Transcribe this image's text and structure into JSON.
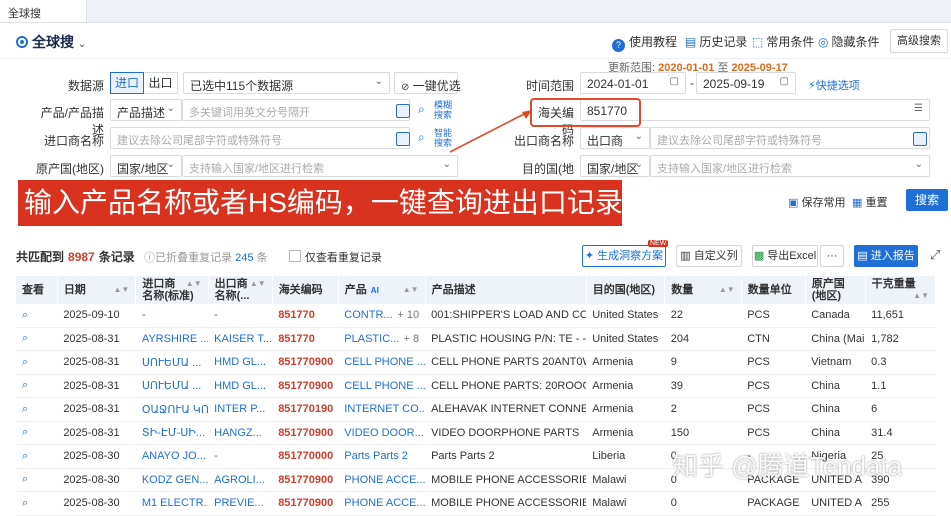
{
  "window": {
    "tab_title": "全球搜"
  },
  "header": {
    "logo": "全球搜",
    "nav": [
      "使用教程",
      "历史记录",
      "常用条件",
      "隐藏条件"
    ],
    "advanced": "高级搜索",
    "update_label": "更新范围:",
    "update_from": "2020-01-01",
    "update_to_word": "至",
    "update_to": "2025-09-17"
  },
  "form": {
    "datasource_label": "数据源",
    "import_label": "进口",
    "export_label": "出口",
    "datasource_value": "已选中115个数据源",
    "one_click": "一键优选",
    "time_label": "时间范围",
    "date_from": "2024-01-01",
    "date_to": "2025-09-19",
    "quick_options": "快捷选项",
    "product_label": "产品/产品描述",
    "product_type": "产品描述",
    "product_placeholder": "多关键词用英文分号隔开",
    "fuzzy_label1": "模糊",
    "fuzzy_label2": "搜索",
    "hs_label": "海关编码",
    "hs_value": "851770",
    "importer_label": "进口商名称",
    "importer_placeholder": "建议去除公司尾部字符或特殊符号",
    "smart_label1": "智能",
    "smart_label2": "搜索",
    "exporter_label": "出口商名称",
    "exporter_type": "出口商",
    "exporter_placeholder": "建议去除公司尾部字符或特殊符号",
    "origin_label": "原产国(地区)",
    "origin_type": "国家/地区",
    "origin_placeholder": "支持输入国家/地区进行检索",
    "dest_label": "目的国(地区)",
    "dest_type": "国家/地区",
    "dest_placeholder": "支持输入国家/地区进行检索",
    "save_common": "保存常用",
    "reset": "重置",
    "search": "搜索"
  },
  "banner": {
    "text": "输入产品名称或者HS编码，一键查询进出口记录"
  },
  "results": {
    "matched_label": "共匹配到",
    "count": "8987",
    "unit": "条记录",
    "folded_label": "已折叠重复记录",
    "folded_count": "245",
    "folded_unit": "条",
    "only_dup": "仅查看重复记录",
    "gen_solution": "生成洞察方案",
    "new_tag": "NEW",
    "custom_cols": "自定义列",
    "export_excel": "导出Excel",
    "more": "···",
    "report": "进入报告"
  },
  "table": {
    "headers": [
      "查看",
      "日期",
      "进口商名称(标准)",
      "出口商名称(...",
      "海关编码",
      "产品",
      "产品描述",
      "目的国(地区)",
      "数量",
      "数量单位",
      "原产国(地区)",
      "干克重量"
    ],
    "ai_tag": "AI",
    "rows": [
      [
        "2025-09-10",
        "-",
        "-",
        "851770",
        "CONTR...",
        "+ 10",
        "001:SHIPPER'S LOAD AND COU...",
        "United States",
        "22",
        "PCS",
        "Canada",
        "11,651"
      ],
      [
        "2025-08-31",
        "AYRSHIRE ...",
        "KAISER T...",
        "851770",
        "PLASTIC...",
        "+ 8",
        "PLASTIC HOUSING P/N: TE - - -...",
        "United States",
        "204",
        "CTN",
        "China (Mai",
        "1,782"
      ],
      [
        "2025-08-31",
        "ՍՈՒԵՄԱ ...",
        "HMD GL...",
        "851770900",
        "CELL PHONE ...",
        "",
        "CELL PHONE PARTS 20ANT0W...",
        "Armenia",
        "9",
        "PCS",
        "Vietnam",
        "0.3"
      ],
      [
        "2025-08-31",
        "ՍՈՒԵՄԱ ...",
        "HMD GL...",
        "851770900",
        "CELL PHONE ...",
        "",
        "CELL PHONE PARTS: 20ROOOW...",
        "Armenia",
        "39",
        "PCS",
        "China",
        "1.1"
      ],
      [
        "2025-08-31",
        "ՕԱՋՈՒԱ ԿՈ...",
        "INTER P...",
        "851770190",
        "INTERNET CO...",
        "",
        "ALEHAVAK INTERNET CONNEC...",
        "Armenia",
        "2",
        "PCS",
        "China",
        "6"
      ],
      [
        "2025-08-31",
        "ՏԻ-ԷՄ-ՍԻ...",
        "HANGZ...",
        "851770900",
        "VIDEO DOOR...",
        "",
        "VIDEO DOORPHONE PARTS",
        "Armenia",
        "150",
        "PCS",
        "China",
        "31.4"
      ],
      [
        "2025-08-30",
        "ANAYO JO...",
        "-",
        "851770000",
        "Parts Parts 2",
        "",
        "Parts Parts 2",
        "Liberia",
        "0",
        "-",
        "Nigeria",
        "25"
      ],
      [
        "2025-08-30",
        "KODZ GEN...",
        "AGROLI...",
        "851770900",
        "PHONE ACCE...",
        "",
        "MOBILE PHONE ACCESSORIES",
        "Malawi",
        "0",
        "PACKAGE",
        "UNITED A",
        "390"
      ],
      [
        "2025-08-30",
        "M1 ELECTR...",
        "PREVIE...",
        "851770900",
        "PHONE ACCE...",
        "",
        "MOBILE PHONE ACCESSORIES",
        "Malawi",
        "0",
        "PACKAGE",
        "UNITED A",
        "255"
      ]
    ]
  },
  "watermark": "知乎 @腾道Tendata"
}
